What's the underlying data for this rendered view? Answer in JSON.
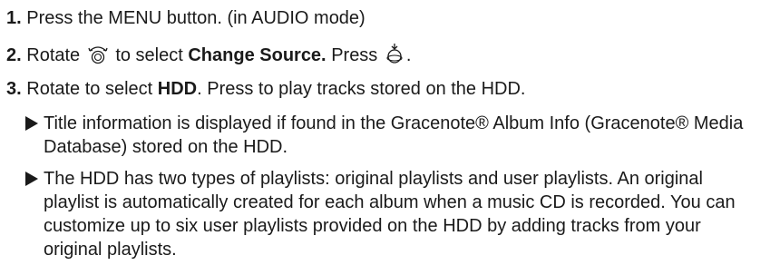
{
  "steps": [
    {
      "num": "1.",
      "text": "Press the MENU button. (in AUDIO mode)"
    },
    {
      "num": "2.",
      "pre": "Rotate",
      "icon_rotate": "interface-dial-rotate-icon",
      "mid": "to select",
      "bold": "Change Source.",
      "post": "Press",
      "icon_press": "interface-dial-press-icon",
      "end": "."
    },
    {
      "num": "3.",
      "pre": "Rotate to select",
      "bold": "HDD",
      "post": ". Press to play tracks stored on the HDD."
    }
  ],
  "notes": [
    {
      "text": "Title information is displayed if found in the Gracenote® Album Info (Gracenote® Media Database) stored on the HDD."
    },
    {
      "text": "The HDD has two types of playlists: original playlists and user playlists. An original playlist is automatically created for each album when a music CD is recorded. You can customize up to six user playlists provided on the HDD by adding tracks from your original playlists."
    }
  ],
  "colors": {
    "text": "#1a1a1a",
    "background": "#ffffff"
  }
}
